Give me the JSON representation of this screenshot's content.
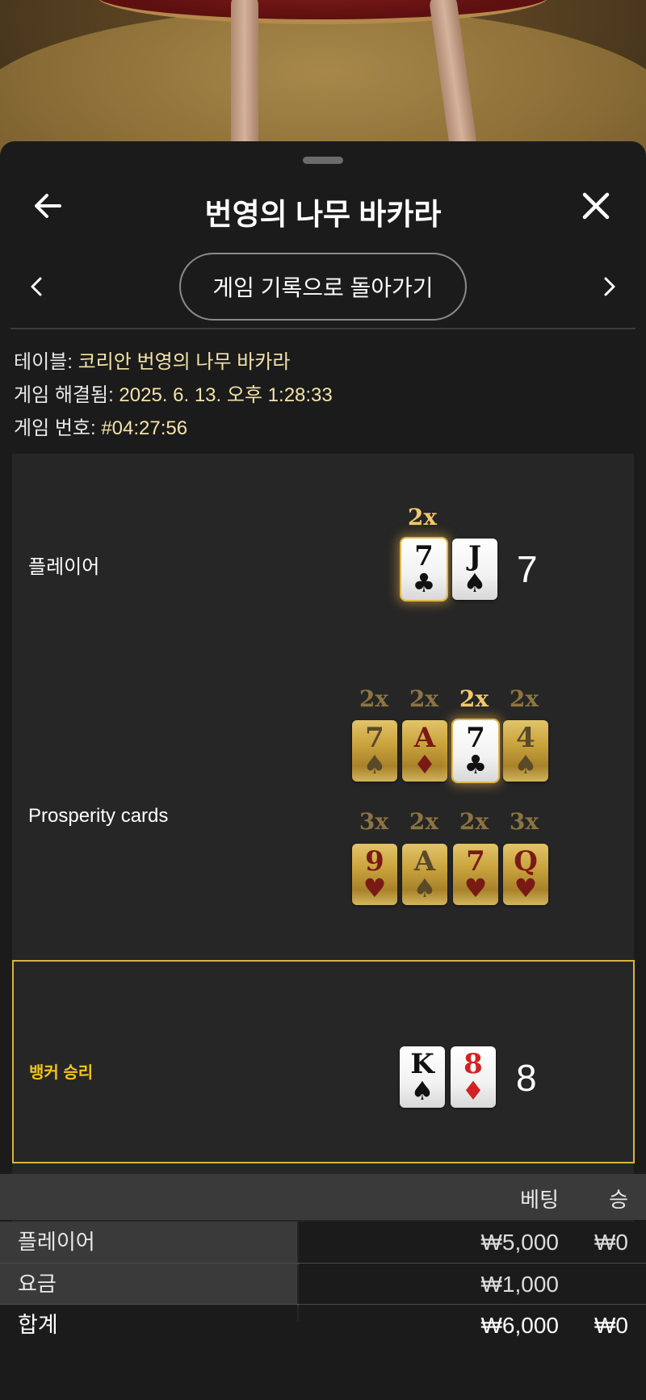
{
  "header": {
    "title": "번영의 나무 바카라"
  },
  "nav": {
    "back_history_label": "게임 기록으로 돌아가기"
  },
  "info": {
    "table_label": "테이블: ",
    "table_value": "코리안 번영의 나무 바카라",
    "resolved_label": "게임 해결됨: ",
    "resolved_value": "2025. 6. 13. 오후 1:28:33",
    "game_no_label": "게임 번호: ",
    "game_no_value": "#04:27:56"
  },
  "player": {
    "label": "플레이어",
    "score": "7",
    "cards": [
      {
        "rank": "7",
        "suit": "♣",
        "multiplier": "2x"
      },
      {
        "rank": "J",
        "suit": "♠"
      }
    ]
  },
  "prosperity": {
    "label": "Prosperity cards",
    "row1": [
      {
        "rank": "7",
        "suit": "♠",
        "multiplier": "2x"
      },
      {
        "rank": "A",
        "suit": "♦",
        "multiplier": "2x"
      },
      {
        "rank": "7",
        "suit": "♣",
        "multiplier": "2x",
        "highlighted": true
      },
      {
        "rank": "4",
        "suit": "♠",
        "multiplier": "2x"
      }
    ],
    "row2": [
      {
        "rank": "9",
        "suit": "♥",
        "multiplier": "3x"
      },
      {
        "rank": "A",
        "suit": "♠",
        "multiplier": "2x"
      },
      {
        "rank": "7",
        "suit": "♥",
        "multiplier": "2x"
      },
      {
        "rank": "Q",
        "suit": "♥",
        "multiplier": "3x"
      }
    ]
  },
  "banker": {
    "label": "뱅커 승리",
    "score": "8",
    "cards": [
      {
        "rank": "K",
        "suit": "♠"
      },
      {
        "rank": "8",
        "suit": "♦"
      }
    ]
  },
  "bets_table": {
    "headers": {
      "bet": "베팅",
      "win": "승"
    },
    "rows": [
      {
        "label": "플레이어",
        "bet": "₩5,000",
        "win": "₩0"
      },
      {
        "label": "요금",
        "bet": "₩1,000",
        "win": ""
      }
    ],
    "total": {
      "label": "합계",
      "bet": "₩6,000",
      "win": "₩0"
    }
  },
  "colors": {
    "accent_gold": "#f0c419",
    "background": "#1b1b1b",
    "panel": "#262626"
  }
}
